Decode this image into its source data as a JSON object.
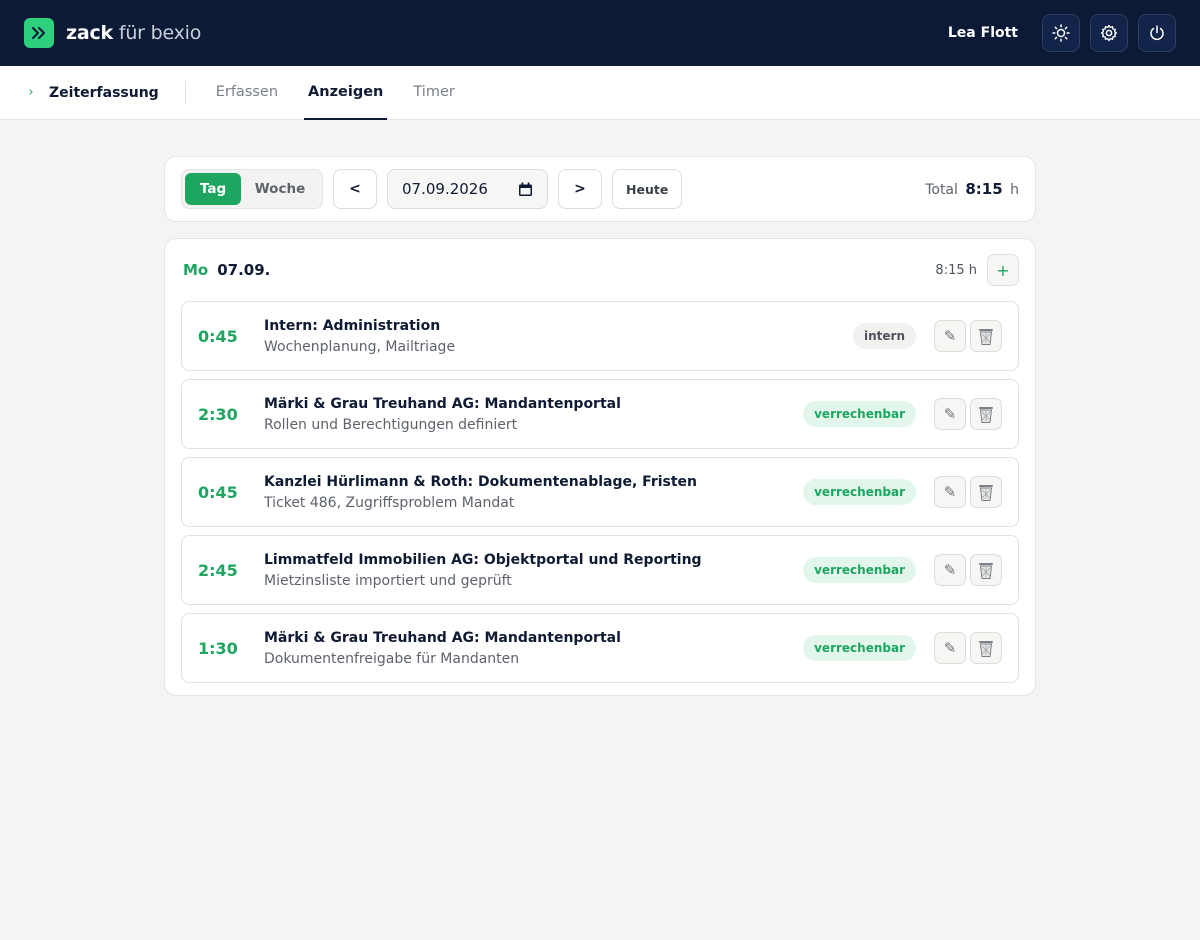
{
  "header": {
    "brand_bold": "zack",
    "brand_light": "für bexio",
    "user_name": "Lea Flott",
    "icons": [
      "sun-icon",
      "gear-icon",
      "power-icon"
    ]
  },
  "subnav": {
    "section": "Zeiterfassung",
    "tabs": [
      {
        "label": "Erfassen",
        "active": false
      },
      {
        "label": "Anzeigen",
        "active": true
      },
      {
        "label": "Timer",
        "active": false
      }
    ]
  },
  "toolbar": {
    "view_day": "Tag",
    "view_week": "Woche",
    "prev": "<",
    "next": ">",
    "date_value": "07.09.2026",
    "today": "Heute",
    "total_label": "Total",
    "total_value": "8:15",
    "total_unit": "h"
  },
  "day": {
    "weekday": "Mo",
    "date": "07.09.",
    "sum": "8:15 h",
    "add": "+",
    "entries": [
      {
        "duration": "0:45",
        "title": "Intern: Administration",
        "description": "Wochenplanung, Mailtriage",
        "tag": "intern",
        "tag_type": "intern"
      },
      {
        "duration": "2:30",
        "title": "Märki & Grau Treuhand AG: Mandantenportal",
        "description": "Rollen und Berechtigungen definiert",
        "tag": "verrechenbar",
        "tag_type": "bill"
      },
      {
        "duration": "0:45",
        "title": "Kanzlei Hürlimann & Roth: Dokumentenablage, Fristen",
        "description": "Ticket 486, Zugriffsproblem Mandat",
        "tag": "verrechenbar",
        "tag_type": "bill"
      },
      {
        "duration": "2:45",
        "title": "Limmatfeld Immobilien AG: Objektportal und Reporting",
        "description": "Mietzinsliste importiert und geprüft",
        "tag": "verrechenbar",
        "tag_type": "bill"
      },
      {
        "duration": "1:30",
        "title": "Märki & Grau Treuhand AG: Mandantenportal",
        "description": "Dokumentenfreigabe für Mandanten",
        "tag": "verrechenbar",
        "tag_type": "bill"
      }
    ]
  },
  "colors": {
    "accent": "#1ea661",
    "topbar": "#0c1a36",
    "background": "#f4f4f2"
  }
}
